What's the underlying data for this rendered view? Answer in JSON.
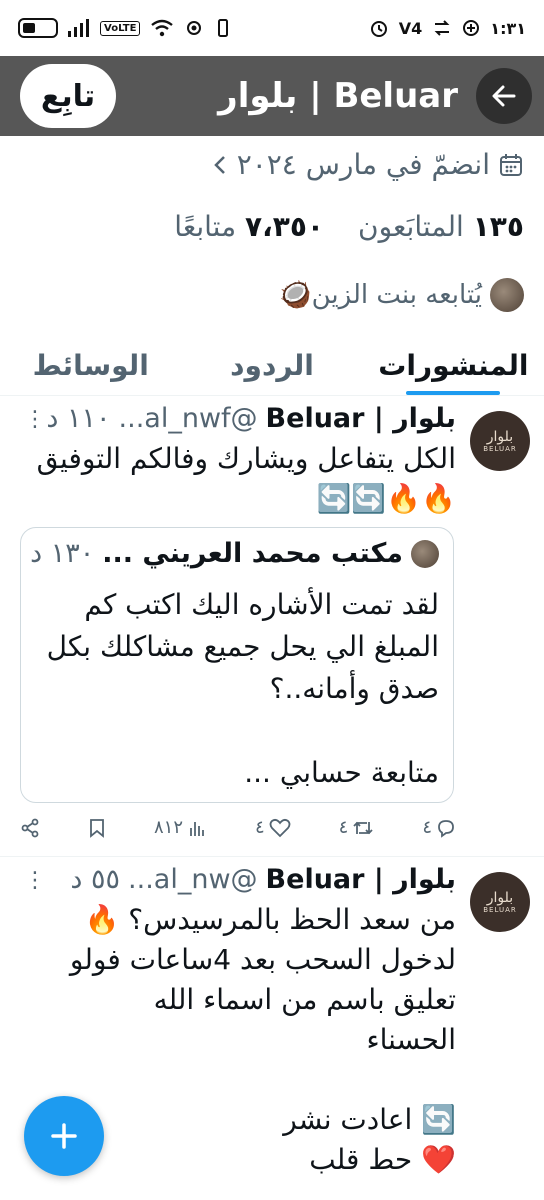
{
  "status_bar": {
    "time": "١:٣١",
    "volte": "VoLTE",
    "carrier": "V4"
  },
  "header": {
    "title": "بلوار | Beluar",
    "follow_label": "تابِع"
  },
  "profile": {
    "joined": "انضمّ في مارس ٢٠٢٤",
    "following_count": "١٣٥",
    "following_label": "المتابَعون",
    "followers_count": "٧،٣٥٠",
    "followers_label": "متابعًا",
    "followed_by": "يُتابعه بنت الزين🥥"
  },
  "tabs": [
    {
      "label": "المنشورات",
      "active": true
    },
    {
      "label": "الردود",
      "active": false
    },
    {
      "label": "الوسائط",
      "active": false
    }
  ],
  "tweets": [
    {
      "avatar_text": "بلوار",
      "avatar_sub": "BELUAR",
      "name": "بلوار | Beluar",
      "handle": "@al_nwf...",
      "time": "١١٠ د",
      "body": "الكل يتفاعل ويشارك وفالكم التوفيق 🔥🔥🔄🔄",
      "quote": {
        "name": "مكتب محمد العريني ...",
        "time": "١٣٠ د",
        "body": "لقد تمت الأشاره اليك اكتب كم المبلغ الي يحل جميع مشاكلك بكل صدق وأمانه..؟",
        "more": "متابعة حسابي ..."
      },
      "actions": {
        "replies": "٤",
        "reposts": "٤",
        "likes": "٤",
        "views": "٨١٢"
      }
    },
    {
      "avatar_text": "بلوار",
      "avatar_sub": "BELUAR",
      "name": "بلوار | Beluar",
      "handle": "@al_nw...",
      "time": "٥٥ د",
      "body_lines": [
        "من سعد الحظ بالمرسيدس؟ 🔥",
        "لدخول السحب بعد 4ساعات فولو",
        "تعليق باسم من اسماء الله",
        "الحسناء",
        "",
        "🔄 اعادت نشر",
        "❤️ حط قلب"
      ]
    }
  ],
  "icons": {
    "back": "arrow-left-icon",
    "calendar": "calendar-icon",
    "chevron": "chevron-left-icon",
    "reply": "reply-icon",
    "repost": "repost-icon",
    "like": "heart-icon",
    "views": "bar-chart-icon",
    "bookmark": "bookmark-icon",
    "share": "share-icon",
    "compose": "plus-icon"
  },
  "colors": {
    "accent": "#1d9bf0",
    "text": "#0f1419",
    "secondary": "#536471",
    "header_bg": "#575757"
  }
}
